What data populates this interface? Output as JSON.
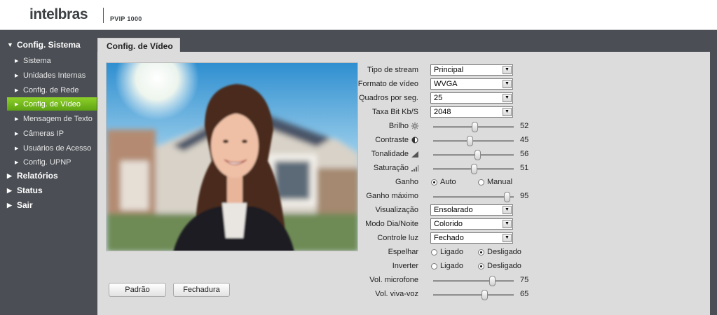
{
  "header": {
    "brand": "intelbras",
    "model": "PVIP 1000"
  },
  "sidebar": {
    "sections": [
      {
        "label": "Config. Sistema",
        "expanded": true
      },
      {
        "label": "Relatórios",
        "expanded": false
      },
      {
        "label": "Status",
        "expanded": false
      },
      {
        "label": "Sair",
        "expanded": false
      }
    ],
    "items": [
      {
        "label": "Sistema"
      },
      {
        "label": "Unidades Internas"
      },
      {
        "label": "Config. de Rede"
      },
      {
        "label": "Config. de Vídeo",
        "active": true
      },
      {
        "label": "Mensagem de Texto"
      },
      {
        "label": "Câmeras IP"
      },
      {
        "label": "Usuários de Acesso"
      },
      {
        "label": "Config. UPNP"
      }
    ]
  },
  "tab": {
    "title": "Config. de Vídeo"
  },
  "buttons": {
    "default": "Padrão",
    "lock": "Fechadura"
  },
  "form": {
    "stream_type": {
      "label": "Tipo de stream",
      "value": "Principal"
    },
    "video_format": {
      "label": "Formato de vídeo",
      "value": "WVGA"
    },
    "fps": {
      "label": "Quadros por seg.",
      "value": "25"
    },
    "bitrate": {
      "label": "Taxa Bit Kb/S",
      "value": "2048"
    },
    "brightness": {
      "label": "Brilho",
      "value": "52",
      "level": 52
    },
    "contrast": {
      "label": "Contraste",
      "value": "45",
      "level": 45
    },
    "hue": {
      "label": "Tonalidade",
      "value": "56",
      "level": 56
    },
    "saturation": {
      "label": "Saturação",
      "value": "51",
      "level": 51
    },
    "gain": {
      "label": "Ganho",
      "option_auto": "Auto",
      "option_manual": "Manual",
      "selected": "Auto"
    },
    "max_gain": {
      "label": "Ganho máximo",
      "value": "95",
      "level": 95
    },
    "view_mode": {
      "label": "Visualização",
      "value": "Ensolarado"
    },
    "day_night": {
      "label": "Modo Dia/Noite",
      "value": "Colorido"
    },
    "light_control": {
      "label": "Controle luz",
      "value": "Fechado"
    },
    "mirror": {
      "label": "Espelhar",
      "option_on": "Ligado",
      "option_off": "Desligado",
      "selected": "Desligado"
    },
    "invert": {
      "label": "Inverter",
      "option_on": "Ligado",
      "option_off": "Desligado",
      "selected": "Desligado"
    },
    "mic_volume": {
      "label": "Vol. microfone",
      "value": "75",
      "level": 75
    },
    "speaker_volume": {
      "label": "Vol. viva-voz",
      "value": "65",
      "level": 65
    }
  },
  "colors": {
    "active_item": "#6ab61a",
    "sidebar_bg": "#4b4f55",
    "panel_bg": "#dcdcdc"
  },
  "icons": {
    "brightness": "sun-icon",
    "contrast": "half-circle-icon",
    "hue": "gradient-triangle-icon",
    "saturation": "bars-triangle-icon"
  }
}
